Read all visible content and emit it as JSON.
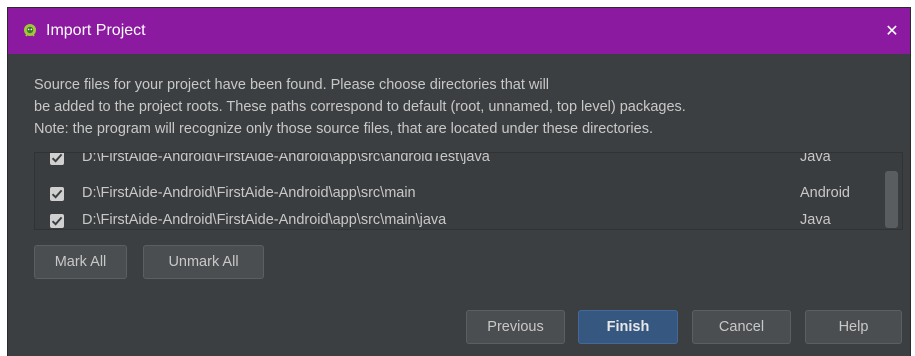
{
  "window": {
    "title": "Import Project",
    "icon": "android-studio-icon",
    "close_glyph": "✕",
    "titlebar_color": "#8c1aa1"
  },
  "description": {
    "line1": "Source files for your project have been found. Please choose directories that will",
    "line2": "be added to the project roots. These paths correspond to default (root, unnamed, top level) packages.",
    "line3": "Note: the program will recognize only those source files, that are located under these directories."
  },
  "roots": [
    {
      "checked": true,
      "path": "D:\\FirstAide-Android\\FirstAide-Android\\app\\src\\androidTest\\java",
      "kind": "Java"
    },
    {
      "checked": true,
      "path": "D:\\FirstAide-Android\\FirstAide-Android\\app\\src\\main",
      "kind": "Android"
    },
    {
      "checked": true,
      "path": "D:\\FirstAide-Android\\FirstAide-Android\\app\\src\\main\\java",
      "kind": "Java"
    }
  ],
  "actions": {
    "mark_all": "Mark All",
    "unmark_all": "Unmark All"
  },
  "footer": {
    "previous": "Previous",
    "finish": "Finish",
    "cancel": "Cancel",
    "help": "Help"
  }
}
